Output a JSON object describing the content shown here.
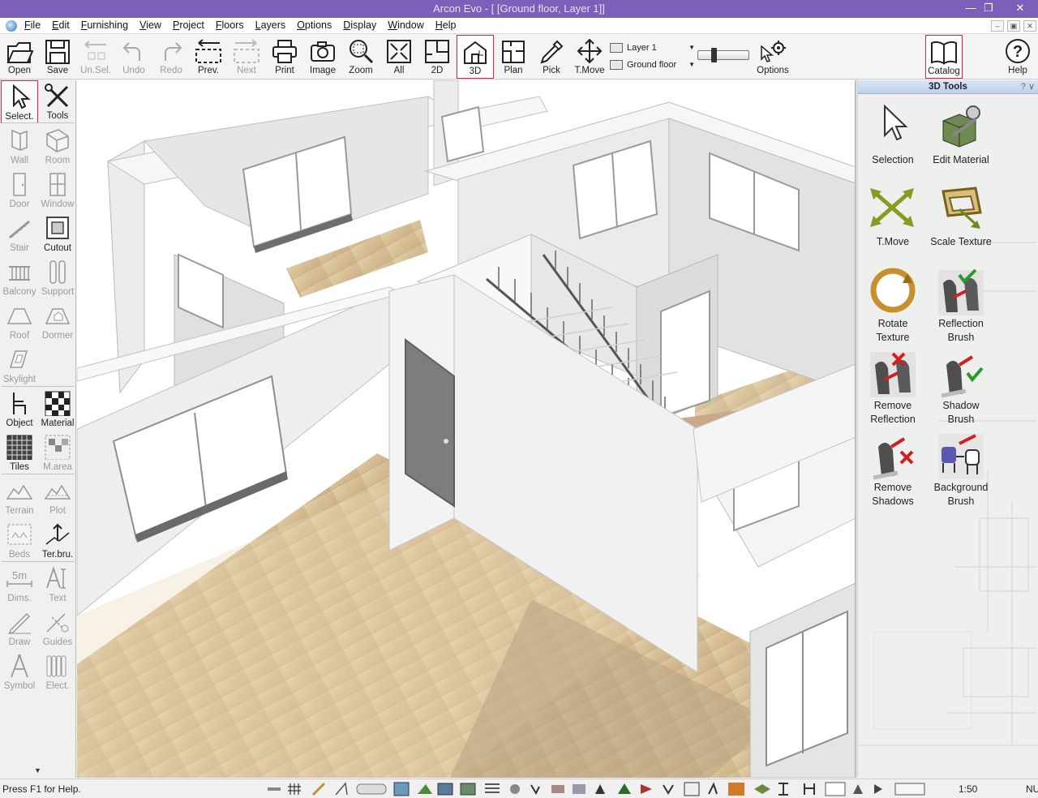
{
  "window": {
    "title": "Arcon Evo - [ [Ground floor, Layer 1]]",
    "controls": [
      "minimize",
      "restore",
      "close"
    ]
  },
  "menu": {
    "items": [
      "File",
      "Edit",
      "Furnishing",
      "View",
      "Project",
      "Floors",
      "Layers",
      "Options",
      "Display",
      "Window",
      "Help"
    ]
  },
  "toolbar": {
    "open": "Open",
    "save": "Save",
    "unsel": "Un.Sel.",
    "undo": "Undo",
    "redo": "Redo",
    "prev": "Prev.",
    "next": "Next",
    "print": "Print",
    "image": "Image",
    "zoom": "Zoom",
    "all": "All",
    "twod": "2D",
    "threed": "3D",
    "plan": "Plan",
    "pick": "Pick",
    "tmove": "T.Move",
    "layer": "Layer 1",
    "floor": "Ground floor",
    "options": "Options",
    "catalog": "Catalog",
    "help": "Help"
  },
  "left_tools": {
    "select": "Select.",
    "tools": "Tools",
    "wall": "Wall",
    "room": "Room",
    "door": "Door",
    "window": "Window",
    "stair": "Stair",
    "cutout": "Cutout",
    "balcony": "Balcony",
    "support": "Support",
    "roof": "Roof",
    "dormer": "Dormer",
    "skylight": "Skylight",
    "object": "Object",
    "material": "Material",
    "tiles": "Tiles",
    "marea": "M.area",
    "terrain": "Terrain",
    "plot": "Plot",
    "beds": "Beds",
    "terbru": "Ter.bru.",
    "dims": "Dims.",
    "text": "Text",
    "draw": "Draw",
    "guides": "Guides",
    "symbol": "Symbol",
    "elect": "Elect.",
    "dims_icon_text": "5m"
  },
  "right_panel": {
    "title": "3D Tools",
    "tools": [
      {
        "line1": "Selection",
        "line2": ""
      },
      {
        "line1": "Edit Material",
        "line2": ""
      },
      {
        "line1": "T.Move",
        "line2": ""
      },
      {
        "line1": "Scale Texture",
        "line2": ""
      },
      {
        "line1": "Rotate",
        "line2": "Texture"
      },
      {
        "line1": "Reflection",
        "line2": "Brush"
      },
      {
        "line1": "Remove",
        "line2": "Reflection"
      },
      {
        "line1": "Shadow",
        "line2": "Brush"
      },
      {
        "line1": "Remove",
        "line2": "Shadows"
      },
      {
        "line1": "Background",
        "line2": "Brush"
      }
    ]
  },
  "status": {
    "help": "Press F1 for Help.",
    "scale": "1:50",
    "mode": "NU"
  },
  "colors": {
    "titlebar": "#7b5fb8",
    "active_border": "#dd2244",
    "floor_wood": "#d9c29a",
    "wall": "#e9e9e9"
  }
}
